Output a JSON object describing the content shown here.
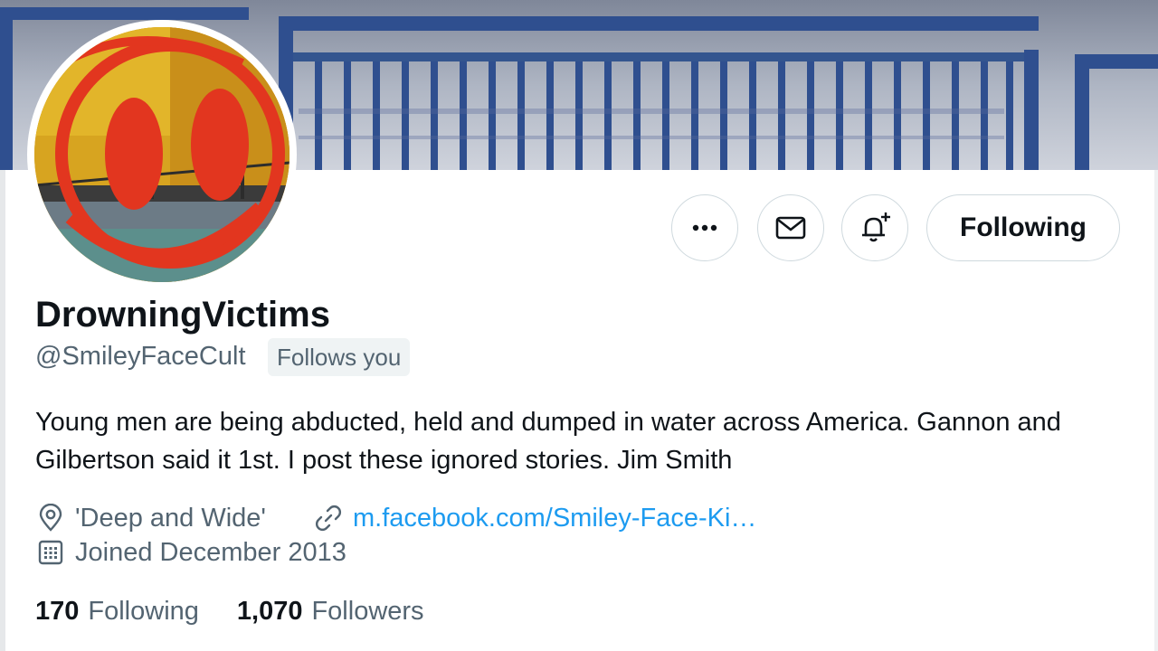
{
  "profile": {
    "display_name": "DrowningVictims",
    "handle": "@SmileyFaceCult",
    "follows_you": "Follows you",
    "bio": "Young men are being abducted, held and dumped in water across America. Gannon and Gilbertson said it 1st. I post these ignored stories. Jim Smith",
    "location": "'Deep and Wide'",
    "website": "m.facebook.com/Smiley-Face-Ki…",
    "joined": "Joined December 2013"
  },
  "actions": {
    "following_label": "Following"
  },
  "counts": {
    "following_value": "170",
    "following_label": "Following",
    "followers_value": "1,070",
    "followers_label": "Followers"
  },
  "colors": {
    "link": "#1d9bf0",
    "text_primary": "#0f1419",
    "text_secondary": "#536471",
    "border": "#cfd9de"
  },
  "icons": {
    "more": "more-horizontal-icon",
    "message": "envelope-icon",
    "notify": "bell-plus-icon",
    "location": "location-pin-icon",
    "link": "link-icon",
    "calendar": "calendar-icon"
  }
}
